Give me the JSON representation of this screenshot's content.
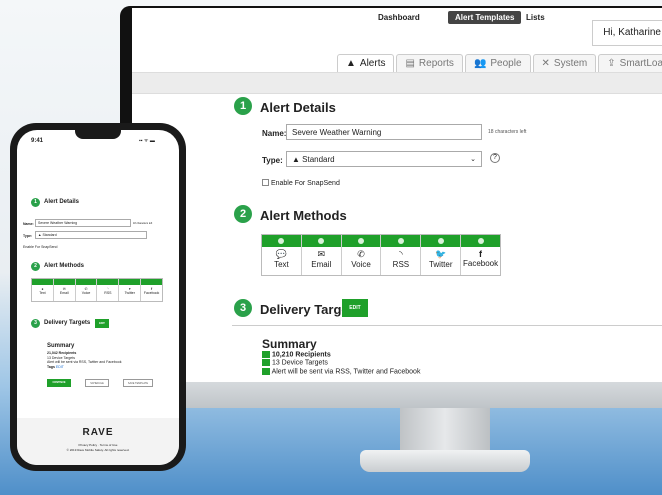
{
  "desktop": {
    "greeting": "Hi, Katharine",
    "tabs": [
      {
        "icon": "warning-icon",
        "label": "Alerts"
      },
      {
        "icon": "reports-icon",
        "label": "Reports"
      },
      {
        "icon": "people-icon",
        "label": "People"
      },
      {
        "icon": "wrench-icon",
        "label": "System"
      },
      {
        "icon": "loader-icon",
        "label": "SmartLoader"
      }
    ],
    "subnav": [
      "Dashboard",
      "Alert Templates",
      "Lists"
    ],
    "sections": {
      "one": {
        "num": "1",
        "title": "Alert Details"
      },
      "two": {
        "num": "2",
        "title": "Alert Methods"
      },
      "three": {
        "num": "3",
        "title": "Delivery Targets"
      }
    },
    "name_label": "Name:",
    "name_value": "Severe Weather Warning",
    "chars_left": "18 characters left",
    "type_label": "Type:",
    "type_value": "Standard",
    "type_help": "?",
    "snapsend": "Enable For SnapSend",
    "methods": [
      {
        "icon": "speech-bubble-icon",
        "glyph": "💬",
        "label": "Text"
      },
      {
        "icon": "envelope-icon",
        "glyph": "✉",
        "label": "Email"
      },
      {
        "icon": "phone-icon",
        "glyph": "✆",
        "label": "Voice"
      },
      {
        "icon": "rss-icon",
        "glyph": "◝",
        "label": "RSS"
      },
      {
        "icon": "twitter-icon",
        "glyph": "🐦",
        "label": "Twitter"
      },
      {
        "icon": "facebook-icon",
        "glyph": "f",
        "label": "Facebook"
      }
    ],
    "edit": "EDIT",
    "summary": {
      "title": "Summary",
      "recipients_count": "10,210",
      "recipients_label": "Recipients",
      "devices": "13 Device Targets",
      "alert_note": "Alert will be sent via RSS, Twitter and Facebook"
    }
  },
  "phone": {
    "time": "9:41",
    "status": "▪▪ ᯤ ▬",
    "sections": {
      "one": {
        "num": "1",
        "title": "Alert Details"
      },
      "two": {
        "num": "2",
        "title": "Alert Methods"
      },
      "three": {
        "num": "3",
        "title": "Delivery Targets"
      }
    },
    "name_label": "Name:",
    "name_value": "Severe Weather Warning",
    "chars_left": "18 characters left",
    "type_label": "Type:",
    "type_value": "Standard",
    "snapsend": "Enable For SnapSend",
    "methods": [
      "Text",
      "Email",
      "Voice",
      "RSS",
      "Twitter",
      "Facebook"
    ],
    "edit": "EDIT",
    "summary": {
      "title": "Summary",
      "recipients": "21,042 Recipients",
      "devices": "13 Device Targets",
      "alert_note": "Alert will be sent via RSS, Twitter and Facebook",
      "tags": "Tags",
      "tags_edit": "EDIT"
    },
    "buttons": {
      "continue": "CONTINUE",
      "schedule": "SCHEDULE",
      "save": "SAVE TEMPLATE"
    },
    "footer": {
      "brand": "RAVE",
      "links": "Privacy Policy · Terms of Use",
      "copyright": "© 2019 Rave Mobile Safety. All rights reserved."
    }
  }
}
